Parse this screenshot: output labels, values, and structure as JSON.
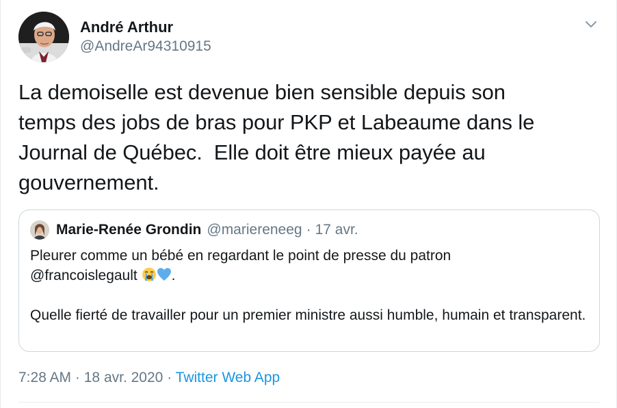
{
  "author": {
    "display_name": "André Arthur",
    "handle": "@AndreAr94310915"
  },
  "tweet": {
    "text": "La demoiselle est devenue bien sensible depuis son\ntemps des jobs de bras pour PKP et Labeaume dans le\nJournal de Québec.  Elle doit être mieux payée au\ngouvernement."
  },
  "quoted_tweet": {
    "display_name": "Marie-Renée Grondin",
    "handle": "@marierenееg",
    "separator": "·",
    "date": "17 avr.",
    "line1": "Pleurer comme un bébé en regardant le point de presse du patron",
    "mention": "@francoislegault",
    "after_emoji": ".",
    "paragraph2": "Quelle fierté de travailler pour un premier ministre aussi humble, humain et transparent.",
    "emojis": [
      "crying-face-emoji",
      "blue-heart-emoji"
    ]
  },
  "footer": {
    "time": "7:28 AM",
    "separator": "·",
    "date": "18 avr. 2020",
    "source_separator": "·",
    "source": "Twitter Web App"
  },
  "colors": {
    "text": "#14171a",
    "secondary": "#657786",
    "link": "#1b95e0",
    "border": "#ccd6dd",
    "divider": "#e6ecf0"
  },
  "icons": [
    "chevron-down-icon"
  ]
}
